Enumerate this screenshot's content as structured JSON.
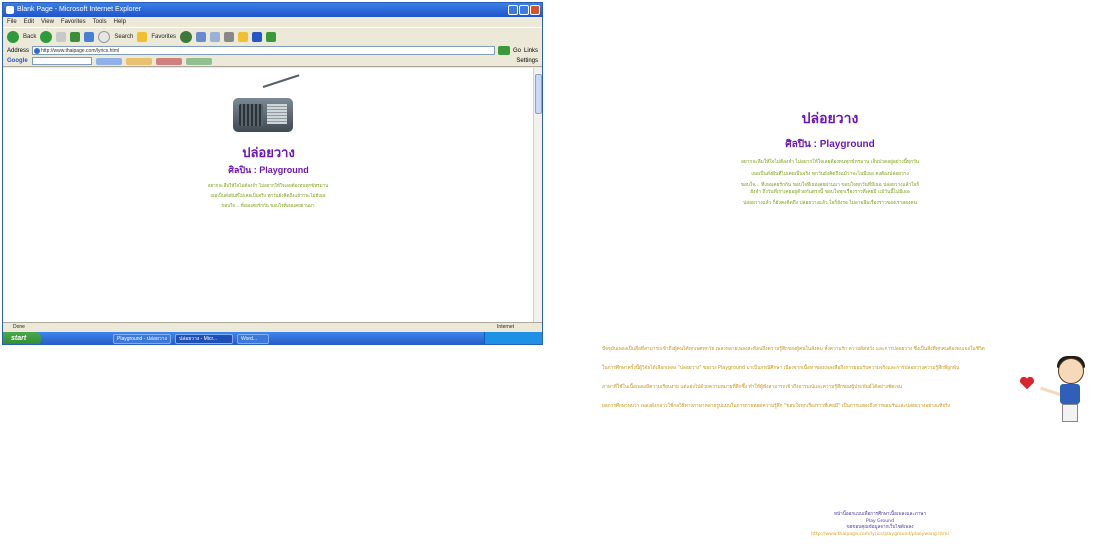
{
  "browser": {
    "window_title": "Blank Page - Microsoft Internet Explorer",
    "menu": [
      "File",
      "Edit",
      "View",
      "Favorites",
      "Tools",
      "Help"
    ],
    "toolbar": {
      "back_label": "Back",
      "search_label": "Search",
      "favorites_label": "Favorites"
    },
    "address": {
      "label": "Address",
      "value": "http://www.thaipage.com/lyrics.html",
      "go_label": "Go",
      "links_label": "Links"
    },
    "google": {
      "label": "Google",
      "settings_label": "Settings"
    },
    "status": {
      "left": "Done",
      "zone": "Internet"
    },
    "taskbar": {
      "start_label": "start",
      "items": [
        "Playground - ปล่อยวาง",
        "ปล่อยวาง - Micr...",
        "Word..."
      ]
    },
    "page": {
      "title": "ปล่อยวาง",
      "artist": "ศิลปิน : Playground",
      "lyrics": [
        "อยากจะลืมให้ใจไม่ต้องจำ ไม่อยากให้ใจเลยต้องทนทุกข์ทรมาน",
        "เธอเป็นดั่งฝันที่ไม่เคยเป็นจริง ทุกวันยังคิดถึงแม้ว่าจะไม่มีเธอ",
        "ขอบใจ... ที่เธอเคยรักกัน ขอบใจที่เธอเคยผ่านมา"
      ]
    }
  },
  "page": {
    "title": "ปล่อยวาง",
    "artist": "ศิลปิน : Playground",
    "lyrics": [
      "อยากจะลืมให้ใจไม่ต้องจำ ไม่อยากให้ใจเลยต้องทนทุกข์ทรมาน เจ็บปวดอยู่อย่างนี้ทุกวัน",
      "เธอเป็นดั่งฝันที่ไม่เคยเป็นจริง ทุกวันยังคิดถึงแม้ว่าจะไม่มีเธอ คงต้องปล่อยวาง",
      "ขอบใจ... ที่เธอเคยรักกัน ขอบใจที่เธอเคยผ่านมา ขอบใจทุกวันที่มีเธอ ปล่อยวางแล้วใจก็ยังจำ ถึงวันที่เราเคยอยู่ด้วยกันตรงนี้ ขอบใจทุกเรื่องราวที่เคยมี แม้วันนี้ไม่มีเธอ",
      "ปล่อยวางแล้ว ก็ยังคงคิดถึง ปล่อยวางแล้ว ใจก็ยังรอ ไม่อาจลืมเรื่องราวของเราสองคน"
    ],
    "essay": [
      "ปัจจุบันเพลงเป็นสื่อที่สามารถเข้าถึงผู้คนได้ทุกเพศทุกวัย เพลงหลายเพลงสะท้อนถึงความรู้สึกของผู้คนในสังคม ทั้งความรัก ความผิดหวัง และการปล่อยวาง ซึ่งเป็นสิ่งที่ทุกคนต้องพบเจอในชีวิต",
      "ในการศึกษาครั้งนี้ผู้วิจัยได้เลือกเพลง \"ปล่อยวาง\" ของวง Playground มาเป็นกรณีศึกษา เนื่องจากเนื้อหาของเพลงสื่อถึงการยอมรับความจริงและการปล่อยวางความรู้สึกที่ผูกพัน",
      "ภาษาที่ใช้ในเนื้อเพลงมีความเรียบง่าย แต่แฝงไปด้วยความหมายที่ลึกซึ้ง ทำให้ผู้ฟังสามารถเข้าถึงอารมณ์และความรู้สึกของผู้ประพันธ์ได้อย่างชัดเจน",
      "ผลการศึกษาพบว่า เพลงดังกล่าวใช้กลวิธีทางภาษาหลายรูปแบบในการถ่ายทอดความรู้สึก \"ขอบใจทุกเรื่องราวที่เคยมี\" เป็นการแสดงถึงการยอมรับและปล่อยวางอย่างแท้จริง"
    ],
    "footer": [
      "หน้านี้ออกแบบเพื่อการศึกษาเนื้อเพลงและภาษา",
      "Play Ground",
      "ขอขอบคุณข้อมูลจากเว็บไซต์เพลง",
      "http://www.thaipage.com/lyrics/playground/plaoywang.html"
    ]
  },
  "colors": {
    "title_purple": "#6a18b8",
    "lyrics_green": "#7aa018",
    "essay_gold": "#c89418",
    "footer_blue": "#4b3aa0",
    "xp_blue": "#2456c7"
  },
  "icons": [
    "radio-image",
    "boy-cartoon",
    "heart-icon",
    "ie-icon",
    "back-icon",
    "forward-icon",
    "search-icon",
    "favorites-icon",
    "google-icon"
  ]
}
